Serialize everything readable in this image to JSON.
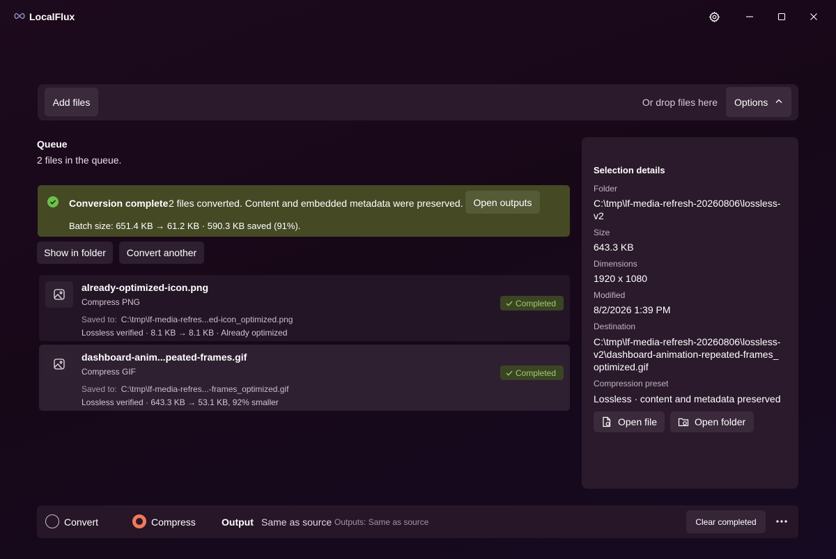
{
  "app": {
    "title": "LocalFlux"
  },
  "toolbar": {
    "add_files": "Add files",
    "drop_hint": "Or drop files here",
    "options": "Options"
  },
  "queue": {
    "title": "Queue",
    "subtitle": "2 files in the queue."
  },
  "banner": {
    "title": "Conversion complete",
    "message": "2 files converted. Content and embedded metadata were preserved.",
    "open_outputs": "Open outputs",
    "batch": "Batch size: 651.4 KB → 61.2 KB · 590.3 KB saved (91%).",
    "color": "#454a25"
  },
  "actions": {
    "show_in_folder": "Show in folder",
    "convert_another": "Convert another"
  },
  "items": [
    {
      "name": "already-optimized-icon.png",
      "type": "Compress PNG",
      "saved_label": "Saved to:",
      "saved_path": "C:\\tmp\\lf-media-refres...ed-icon_optimized.png",
      "result": "Lossless verified · 8.1 KB → 8.1 KB · Already optimized",
      "status": "Completed"
    },
    {
      "name": "dashboard-anim...peated-frames.gif",
      "type": "Compress GIF",
      "saved_label": "Saved to:",
      "saved_path": "C:\\tmp\\lf-media-refres...-frames_optimized.gif",
      "result": "Lossless verified · 643.3 KB → 53.1 KB, 92% smaller",
      "status": "Completed"
    }
  ],
  "details": {
    "title": "Selection details",
    "folder_label": "Folder",
    "folder": "C:\\tmp\\lf-media-refresh-20260806\\lossless-v2",
    "size_label": "Size",
    "size": "643.3 KB",
    "dimensions_label": "Dimensions",
    "dimensions": "1920 x 1080",
    "modified_label": "Modified",
    "modified": "8/2/2026 1:39 PM",
    "destination_label": "Destination",
    "destination": "C:\\tmp\\lf-media-refresh-20260806\\lossless-v2\\dashboard-animation-repeated-frames_optimized.gif",
    "preset_label": "Compression preset",
    "preset": "Lossless · content and metadata preserved",
    "open_file": "Open file",
    "open_folder": "Open folder"
  },
  "bottom": {
    "convert": "Convert",
    "compress": "Compress",
    "selected_mode": "Compress",
    "output_label": "Output",
    "output_value": "Same as source",
    "outputs_note": "Outputs: Same as source",
    "clear_completed": "Clear completed"
  },
  "colors": {
    "accent": "#f07a5a",
    "success": "#9bcf70",
    "panel": "#2a1a2b"
  },
  "icons": [
    "infinity-logo-icon",
    "gear-icon",
    "minimize-icon",
    "maximize-icon",
    "close-icon",
    "chevron-up-icon",
    "check-circle-icon",
    "image-file-icon",
    "checkmark-icon",
    "open-file-icon",
    "open-folder-icon",
    "more-icon"
  ]
}
